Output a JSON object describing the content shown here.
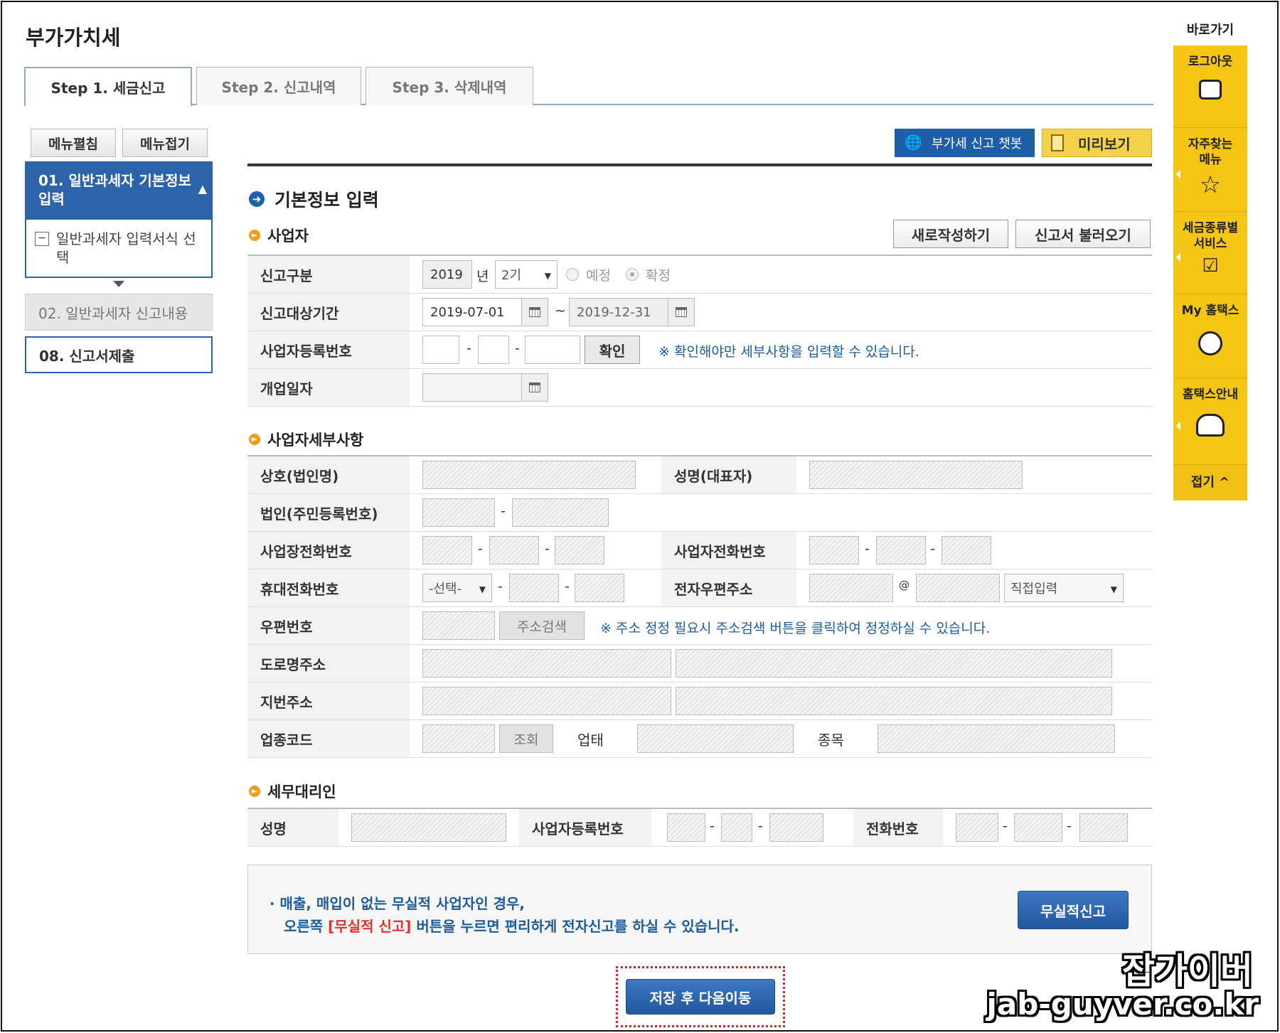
{
  "page": {
    "title": "부가가치세"
  },
  "tabs": [
    {
      "label": "Step 1. 세금신고"
    },
    {
      "label": "Step 2. 신고내역"
    },
    {
      "label": "Step 3. 삭제내역"
    }
  ],
  "left_nav": {
    "expand_all": "메뉴펼침",
    "collapse_all": "메뉴접기",
    "items": [
      {
        "label": "01. 일반과세자 기본정보 입력",
        "sub": "일반과세자 입력서식 선택"
      },
      {
        "label": "02. 일반과세자 신고내용"
      },
      {
        "label": "08. 신고서제출"
      }
    ]
  },
  "toolbar": {
    "chatbot": "부가세 신고 챗봇",
    "preview": "미리보기"
  },
  "section": {
    "title": "기본정보 입력"
  },
  "business": {
    "title": "사업자",
    "new_btn": "새로작성하기",
    "load_btn": "신고서 불러오기",
    "report_type": {
      "label": "신고구분",
      "year": "2019",
      "year_unit": "년",
      "period": "2기",
      "opt_prelim": "예정",
      "opt_final": "확정"
    },
    "period": {
      "label": "신고대상기간",
      "start": "2019-07-01",
      "sep": "~",
      "end": "2019-12-31"
    },
    "reg_no": {
      "label": "사업자등록번호",
      "confirm": "확인",
      "note": "※ 확인해야만 세부사항을 입력할 수 있습니다."
    },
    "open_date": {
      "label": "개업일자"
    }
  },
  "details": {
    "title": "사업자세부사항",
    "company": "상호(법인명)",
    "rep": "성명(대표자)",
    "corp_no": "법인(주민등록번호)",
    "biz_phone": "사업장전화번호",
    "owner_phone": "사업자전화번호",
    "mobile": "휴대전화번호",
    "mobile_select": "-선택-",
    "email": "전자우편주소",
    "at": "@",
    "email_select": "직접입력",
    "zip": "우편번호",
    "addr_search": "주소검색",
    "addr_note": "※ 주소 정정 필요시 주소검색 버튼을 클릭하여 정정하실 수 있습니다.",
    "road_addr": "도로명주소",
    "lot_addr": "지번주소",
    "industry_code": "업종코드",
    "lookup": "조회",
    "biz_type": "업태",
    "biz_item": "종목"
  },
  "agent": {
    "title": "세무대리인",
    "name": "성명",
    "reg_no": "사업자등록번호",
    "phone": "전화번호"
  },
  "info": {
    "line1": "· 매출, 매입이 없는 무실적 사업자인 경우,",
    "line2_pre": "오른쪽 ",
    "line2_red": "[무실적 신고]",
    "line2_post": " 버튼을 누르면 편리하게 전자신고를 하실 수 있습니다.",
    "button": "무실적신고"
  },
  "save_next": "저장 후 다음이동",
  "sidebar": {
    "title": "바로가기",
    "items": [
      "로그아웃",
      "자주찾는 메뉴",
      "세금종류별 서비스",
      "My 홈택스",
      "홈택스안내"
    ],
    "fold": "접기 ^"
  },
  "watermark": {
    "line1": "잡가이버",
    "line2": "jab-guyver.co.kr"
  },
  "colors": {
    "primary": "#2d63a8",
    "accent_yellow": "#f5c516",
    "note_blue": "#1c5b9a",
    "highlight_red": "#e0312a"
  }
}
